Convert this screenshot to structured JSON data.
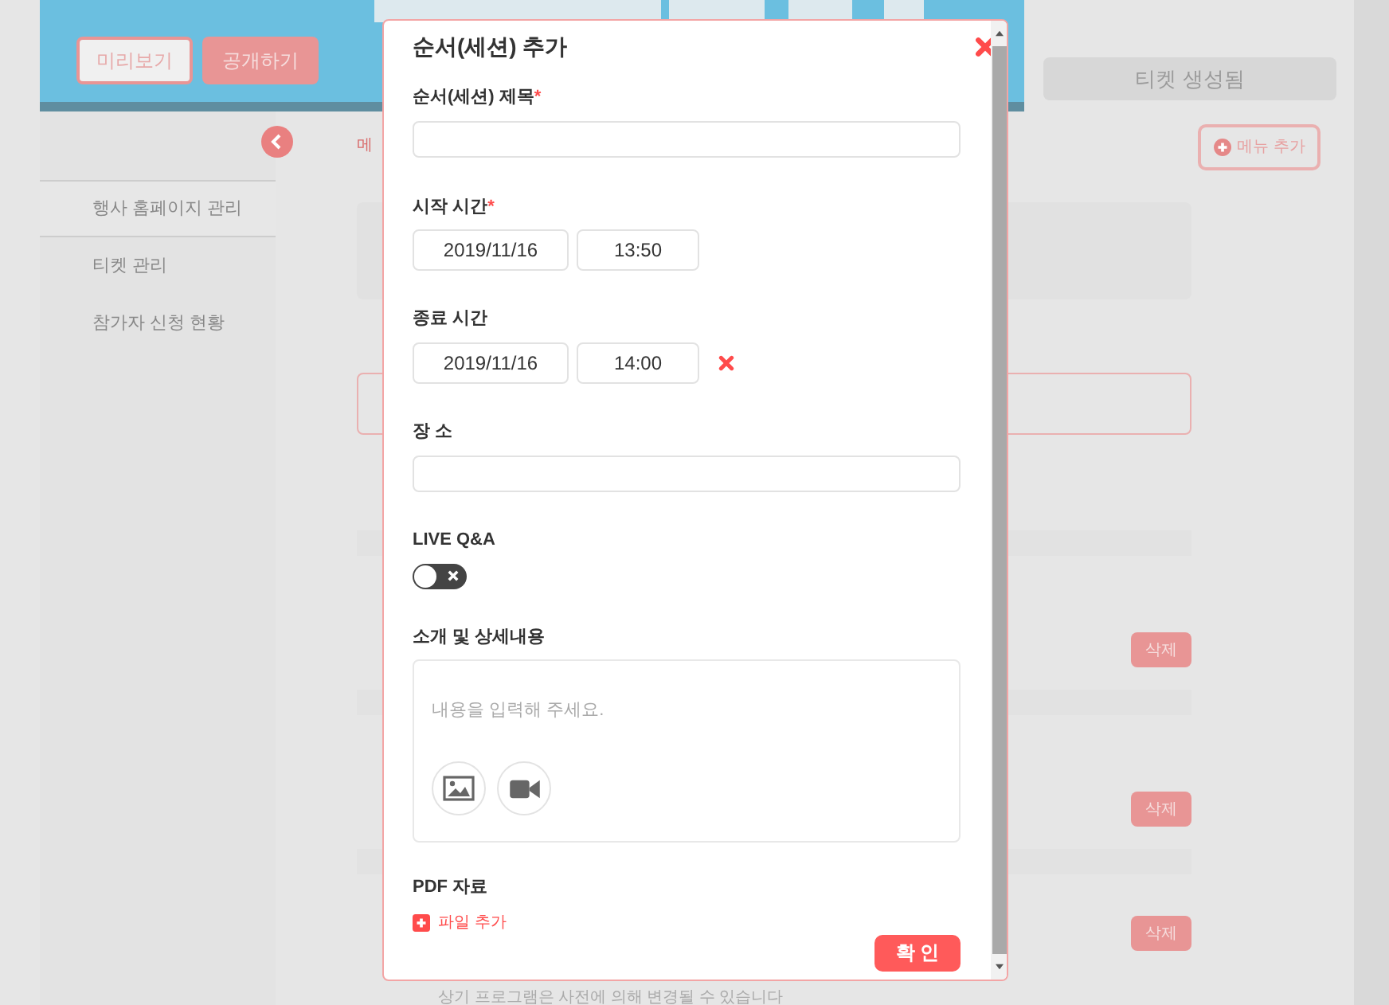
{
  "banner": {
    "buttons": [
      {
        "label": "미리보기",
        "kind": "outline"
      },
      {
        "label": "공개하기",
        "kind": "filled"
      }
    ]
  },
  "ticket_button": {
    "label": "티켓 생성됨",
    "disabled": true
  },
  "sidebar": {
    "items": [
      {
        "label": "행사 홈페이지 관리",
        "selected": true
      },
      {
        "label": "티켓 관리",
        "selected": false
      },
      {
        "label": "참가자 신청 현황",
        "selected": false
      }
    ]
  },
  "content": {
    "menu_tab": "메",
    "add_menu_button": "메뉴 추가",
    "delete_buttons": [
      "삭제",
      "삭제",
      "삭제"
    ],
    "footer_note": "상기 프로그램은 사전에 의해 변경될 수 있습니다"
  },
  "modal": {
    "title": "순서(세션) 추가",
    "fields": [
      {
        "kind": "text",
        "label": "순서(세션) 제목",
        "required_mark": "*"
      },
      {
        "kind": "datetime",
        "label": "시작 시간",
        "required_mark": "*",
        "date": "2019/11/16",
        "time": "13:50",
        "removable": false
      },
      {
        "kind": "datetime",
        "label": "종료 시간",
        "date": "2019/11/16",
        "time": "14:00",
        "removable": true
      },
      {
        "kind": "text",
        "label": "장 소"
      },
      {
        "kind": "toggle",
        "label": "LIVE Q&A",
        "on": false
      },
      {
        "kind": "editor",
        "label": "소개 및 상세내용",
        "placeholder": "내용을 입력해 주세요."
      },
      {
        "kind": "files",
        "label": "PDF 자료",
        "add_label": "파일 추가"
      }
    ],
    "confirm_button": "확 인"
  }
}
